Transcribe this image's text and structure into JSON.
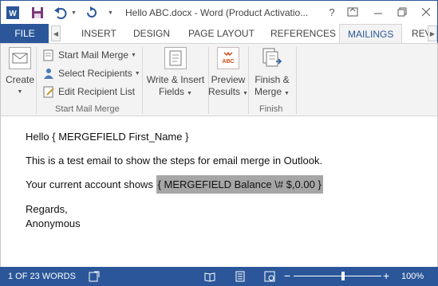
{
  "window": {
    "title": "Hello ABC.docx - Word (Product Activatio...",
    "help_label": "?"
  },
  "tabs": {
    "file": "FILE",
    "items": [
      "INSERT",
      "DESIGN",
      "PAGE LAYOUT",
      "REFERENCES",
      "MAILINGS",
      "REV"
    ],
    "active": "MAILINGS"
  },
  "ribbon": {
    "create": {
      "line1": "Create"
    },
    "start_mail_merge": "Start Mail Merge",
    "select_recipients": "Select Recipients",
    "edit_recipient_list": "Edit Recipient List",
    "group_start": "Start Mail Merge",
    "write_insert": {
      "line1": "Write & Insert",
      "line2": "Fields"
    },
    "preview": {
      "line1": "Preview",
      "line2": "Results",
      "icon_text": "ABC"
    },
    "finish": {
      "line1": "Finish &",
      "line2": "Merge"
    },
    "group_finish": "Finish"
  },
  "document": {
    "line1": "Hello { MERGEFIELD First_Name }",
    "line2": "This is a test email to show the steps for email merge in Outlook.",
    "line3_prefix": "Your current account shows ",
    "line3_field": "{ MERGEFIELD Balance  \\# $,0.00 }",
    "line4": "Regards,",
    "line5": "Anonymous"
  },
  "status": {
    "page_words": "1 OF 23 WORDS",
    "zoom": "100%",
    "zoom_fraction": 0.56
  },
  "colors": {
    "accent": "#2b579a",
    "field_shade": "#a6a6a6"
  }
}
